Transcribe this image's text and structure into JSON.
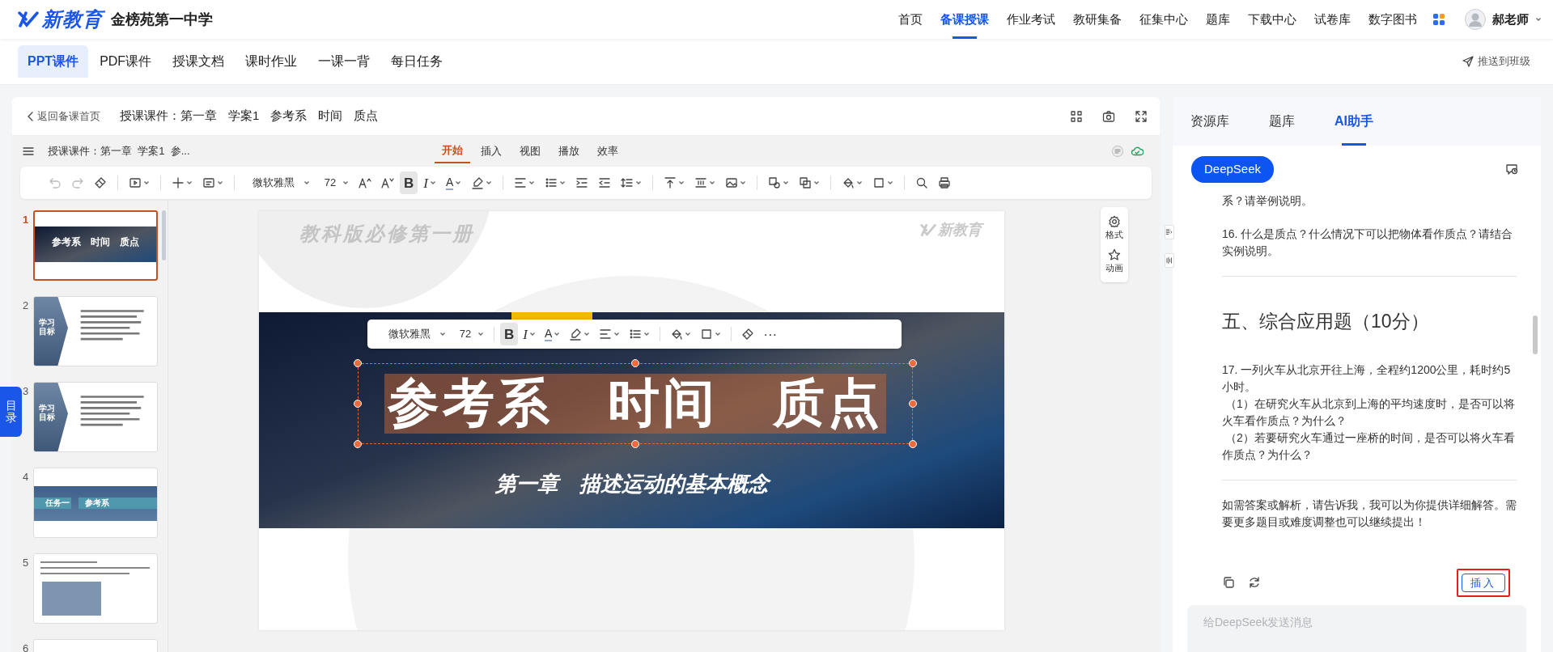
{
  "header": {
    "logo": "新教育",
    "school": "金榜苑第一中学",
    "nav": [
      {
        "label": "首页",
        "selected": false
      },
      {
        "label": "备课授课",
        "selected": true
      },
      {
        "label": "作业考试",
        "selected": false
      },
      {
        "label": "教研集备",
        "selected": false
      },
      {
        "label": "征集中心",
        "selected": false
      },
      {
        "label": "题库",
        "selected": false
      },
      {
        "label": "下载中心",
        "selected": false
      },
      {
        "label": "试卷库",
        "selected": false
      },
      {
        "label": "数字图书",
        "selected": false
      }
    ],
    "user": "郝老师"
  },
  "subtabs": [
    {
      "label": "PPT课件",
      "selected": true
    },
    {
      "label": "PDF课件",
      "selected": false
    },
    {
      "label": "授课文档",
      "selected": false
    },
    {
      "label": "课时作业",
      "selected": false
    },
    {
      "label": "一课一背",
      "selected": false
    },
    {
      "label": "每日任务",
      "selected": false
    }
  ],
  "push_button": "推送到班级",
  "courseware": {
    "back": "返回备课首页",
    "title_parts": [
      "授课课件：第一章",
      "学案1",
      "参考系",
      "时间",
      "质点"
    ]
  },
  "doc_bar": {
    "title": "授课课件：第一章  学案1  参...",
    "tabs": [
      {
        "label": "开始",
        "selected": true
      },
      {
        "label": "插入",
        "selected": false
      },
      {
        "label": "视图",
        "selected": false
      },
      {
        "label": "播放",
        "selected": false
      },
      {
        "label": "效率",
        "selected": false
      }
    ]
  },
  "toolbar": {
    "tools": [
      {
        "kind": "undo",
        "caret": false,
        "disabled": true,
        "active": false
      },
      {
        "kind": "redo",
        "caret": false,
        "disabled": true,
        "active": false
      },
      {
        "kind": "brush",
        "caret": false,
        "disabled": false,
        "active": false
      },
      {
        "kind": "divider"
      },
      {
        "kind": "slideshow",
        "caret": true,
        "disabled": false,
        "active": false
      },
      {
        "kind": "divider"
      },
      {
        "kind": "plus",
        "caret": true,
        "disabled": false,
        "active": false
      },
      {
        "kind": "textbox",
        "caret": true,
        "disabled": false,
        "active": false
      },
      {
        "kind": "divider"
      },
      {
        "kind": "font-select",
        "label": "微软雅黑",
        "caret": true,
        "disabled": false,
        "active": false
      },
      {
        "kind": "size-select",
        "label": "72",
        "caret": true,
        "disabled": false,
        "active": false
      },
      {
        "kind": "font-grow",
        "caret": false,
        "disabled": false,
        "active": false
      },
      {
        "kind": "font-shrink",
        "caret": false,
        "disabled": false,
        "active": false
      },
      {
        "kind": "glyph",
        "label": "B",
        "caret": false,
        "disabled": false,
        "active": true
      },
      {
        "kind": "glyph",
        "label": "I",
        "caret": true,
        "disabled": false,
        "active": false
      },
      {
        "kind": "color-glyph",
        "label": "A",
        "caret": true,
        "disabled": false,
        "active": false
      },
      {
        "kind": "highlight",
        "caret": true,
        "disabled": false,
        "active": false
      },
      {
        "kind": "divider"
      },
      {
        "kind": "align",
        "caret": true,
        "disabled": false,
        "active": false
      },
      {
        "kind": "bullets",
        "caret": true,
        "disabled": false,
        "active": false
      },
      {
        "kind": "indent",
        "caret": false,
        "disabled": false,
        "active": false
      },
      {
        "kind": "outdent",
        "caret": false,
        "disabled": false,
        "active": false
      },
      {
        "kind": "line-spacing",
        "caret": true,
        "disabled": false,
        "active": false
      },
      {
        "kind": "divider"
      },
      {
        "kind": "valign",
        "caret": true,
        "disabled": false,
        "active": false
      },
      {
        "kind": "columns",
        "caret": true,
        "disabled": false,
        "active": false
      },
      {
        "kind": "image",
        "caret": true,
        "disabled": false,
        "active": false
      },
      {
        "kind": "divider"
      },
      {
        "kind": "shape",
        "caret": true,
        "disabled": false,
        "active": false
      },
      {
        "kind": "arrange",
        "caret": true,
        "disabled": false,
        "active": false
      },
      {
        "kind": "divider"
      },
      {
        "kind": "fill",
        "caret": true,
        "disabled": false,
        "active": false
      },
      {
        "kind": "border",
        "caret": true,
        "disabled": false,
        "active": false
      },
      {
        "kind": "divider"
      },
      {
        "kind": "search",
        "caret": false,
        "disabled": false,
        "active": false
      },
      {
        "kind": "print",
        "caret": false,
        "disabled": false,
        "active": false
      }
    ]
  },
  "toc_tab": "目录",
  "thumbnails": [
    {
      "number": "1",
      "selected": true,
      "kind": "title",
      "title": "参考系　时间　质点"
    },
    {
      "number": "2",
      "selected": false,
      "kind": "goals",
      "title": "学习目标"
    },
    {
      "number": "3",
      "selected": false,
      "kind": "goals",
      "title": "学习目标"
    },
    {
      "number": "4",
      "selected": false,
      "kind": "section",
      "labels": [
        "任务一",
        "参考系"
      ]
    },
    {
      "number": "5",
      "selected": false,
      "kind": "text-photo"
    },
    {
      "number": "6",
      "selected": false,
      "kind": "blank"
    }
  ],
  "slide": {
    "series": "教科版必修第一册",
    "logo": "新教育",
    "title": "参考系　时间　质点",
    "subtitle": "第一章　描述运动的基本概念",
    "title_selected": true,
    "float_toolbar": {
      "tools": [
        {
          "kind": "font-select",
          "label": "微软雅黑",
          "caret": true,
          "disabled": false,
          "active": false
        },
        {
          "kind": "size-select",
          "label": "72",
          "caret": true,
          "disabled": false,
          "active": false
        },
        {
          "kind": "divider"
        },
        {
          "kind": "glyph",
          "label": "B",
          "caret": false,
          "disabled": false,
          "active": true
        },
        {
          "kind": "glyph",
          "label": "I",
          "caret": true,
          "disabled": false,
          "active": false
        },
        {
          "kind": "color-glyph",
          "label": "A",
          "caret": true,
          "disabled": false,
          "active": false
        },
        {
          "kind": "highlight",
          "caret": true,
          "disabled": false,
          "active": false
        },
        {
          "kind": "align",
          "caret": true,
          "disabled": false,
          "active": false
        },
        {
          "kind": "bullets",
          "caret": true,
          "disabled": false,
          "active": false
        },
        {
          "kind": "divider"
        },
        {
          "kind": "fill",
          "caret": true,
          "disabled": false,
          "active": false
        },
        {
          "kind": "border",
          "caret": true,
          "disabled": false,
          "active": false
        },
        {
          "kind": "divider"
        },
        {
          "kind": "brush",
          "caret": false,
          "disabled": false,
          "active": false
        },
        {
          "kind": "glyph",
          "label": "···",
          "caret": false,
          "disabled": false,
          "active": false
        }
      ]
    }
  },
  "side_tools": [
    {
      "kind": "gear",
      "label": "格式"
    },
    {
      "kind": "star",
      "label": "动画"
    }
  ],
  "assistant": {
    "tabs": [
      {
        "label": "资源库",
        "selected": false
      },
      {
        "label": "题库",
        "selected": false
      },
      {
        "label": "AI助手",
        "selected": true
      }
    ],
    "model": "DeepSeek",
    "blocks": [
      {
        "kind": "paragraph",
        "lines": [
          "系？请举例说明。"
        ]
      },
      {
        "kind": "paragraph",
        "lines": [
          "16. 什么是质点？什么情况下可以把物体看作质点？请结合实例说明。"
        ]
      },
      {
        "kind": "divider"
      },
      {
        "kind": "heading",
        "lines": [
          "五、综合应用题（10分）"
        ]
      },
      {
        "kind": "paragraph",
        "lines": [
          "17. 一列火车从北京开往上海，全程约1200公里，耗时约5小时。",
          "（1）在研究火车从北京到上海的平均速度时，是否可以将火车看作质点？为什么？",
          "（2）若要研究火车通过一座桥的时间，是否可以将火车看作质点？为什么？"
        ]
      },
      {
        "kind": "divider"
      },
      {
        "kind": "paragraph",
        "lines": [
          "如需答案或解析，请告诉我，我可以为你提供详细解答。需要更多题目或难度调整也可以继续提出！"
        ]
      }
    ],
    "insert_button": "插入",
    "insert_highlighted": true,
    "placeholder": "给DeepSeek发送消息"
  }
}
